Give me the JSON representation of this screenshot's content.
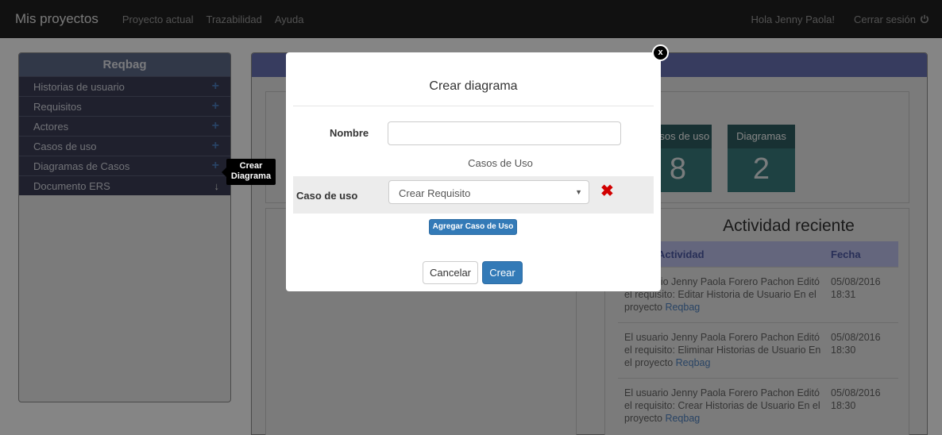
{
  "navbar": {
    "brand": "Mis proyectos",
    "links": [
      "Proyecto actual",
      "Trazabilidad",
      "Ayuda"
    ],
    "greeting": "Hola Jenny Paola!",
    "logout": "Cerrar sesión",
    "logout_icon": "power-icon"
  },
  "sidebar": {
    "title": "Reqbag",
    "items": [
      {
        "label": "Historias de usuario",
        "icon": "plus-icon"
      },
      {
        "label": "Requisitos",
        "icon": "plus-icon"
      },
      {
        "label": "Actores",
        "icon": "plus-icon"
      },
      {
        "label": "Casos de uso",
        "icon": "plus-icon"
      },
      {
        "label": "Diagramas de Casos",
        "icon": "plus-icon"
      },
      {
        "label": "Documento ERS",
        "icon": "download-icon"
      }
    ],
    "tooltip": "Crear Diagrama"
  },
  "stats": [
    {
      "label": "Casos de uso",
      "value": "8"
    },
    {
      "label": "Diagramas",
      "value": "2"
    }
  ],
  "activity": {
    "title": "Actividad reciente",
    "columns": [
      "Actividad",
      "Fecha"
    ],
    "rows": [
      {
        "text": "El usuario Jenny Paola Forero Pachon Editó el requisito: Editar Historia de Usuario En el proyecto",
        "project": "Reqbag",
        "date": "05/08/2016 18:31"
      },
      {
        "text": "El usuario Jenny Paola Forero Pachon Editó el requisito: Eliminar Historias de Usuario En el proyecto",
        "project": "Reqbag",
        "date": "05/08/2016 18:30"
      },
      {
        "text": "El usuario Jenny Paola Forero Pachon Editó el requisito: Crear Historias de Usuario En el proyecto",
        "project": "Reqbag",
        "date": "05/08/2016 18:30"
      }
    ]
  },
  "modal": {
    "close": "x",
    "title": "Crear diagrama",
    "name_label": "Nombre",
    "name_value": "",
    "section_title": "Casos de Uso",
    "case_label": "Caso de uso",
    "case_selected": "Crear Requisito",
    "remove_icon": "close-icon",
    "add_button": "Agregar Caso de Uso",
    "cancel_button": "Cancelar",
    "create_button": "Crear"
  }
}
